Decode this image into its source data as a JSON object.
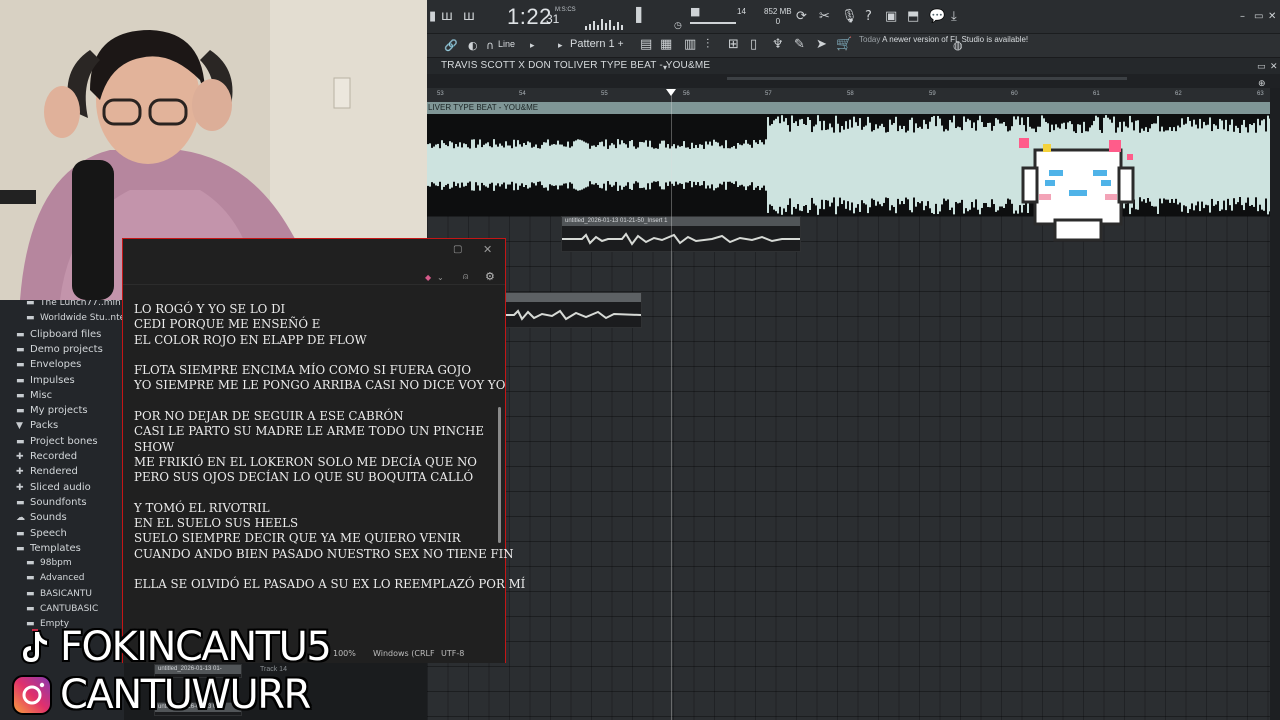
{
  "fl_studio": {
    "time_main": "1:22",
    "time_small": "31",
    "time_unit": "M:S:CS",
    "cpu": "14",
    "memory": "852 MB",
    "memory_sub": "0",
    "snap_mode": "Line",
    "pattern": "Pattern 1",
    "update_notice_prefix": "Today",
    "update_notice": "A newer version of FL Studio is available!",
    "playlist_title": "TRAVIS SCOTT X DON TOLIVER TYPE BEAT - YOU&ME",
    "clip_name": "LIVER TYPE BEAT - YOU&ME",
    "bar_numbers": [
      "53",
      "54",
      "55",
      "56",
      "57",
      "58",
      "59",
      "60",
      "61",
      "62",
      "63"
    ],
    "recording_clip": "untitled_2026-01-13 01-21-50_Insert 1",
    "bottom_clip": "untitled_2026-01-13 01-",
    "bottom_clip2": "untitled_2026-01-13 01-",
    "track_label": "Track 14"
  },
  "browser": {
    "items": [
      {
        "label": "The Lunch77..min Dr",
        "icon": "folder-icon",
        "sub": true
      },
      {
        "label": "Worldwide Stu..nters E",
        "icon": "folder-icon",
        "sub": true
      },
      {
        "label": "Clipboard files",
        "icon": "folder-icon",
        "sub": false
      },
      {
        "label": "Demo projects",
        "icon": "folder-icon",
        "sub": false
      },
      {
        "label": "Envelopes",
        "icon": "folder-icon",
        "sub": false
      },
      {
        "label": "Impulses",
        "icon": "folder-icon",
        "sub": false
      },
      {
        "label": "Misc",
        "icon": "folder-icon",
        "sub": false
      },
      {
        "label": "My projects",
        "icon": "folder-icon",
        "sub": false
      },
      {
        "label": "Packs",
        "icon": "packs-icon",
        "sub": false
      },
      {
        "label": "Project bones",
        "icon": "folder-icon",
        "sub": false
      },
      {
        "label": "Recorded",
        "icon": "plus-icon",
        "sub": false
      },
      {
        "label": "Rendered",
        "icon": "plus-icon",
        "sub": false
      },
      {
        "label": "Sliced audio",
        "icon": "plus-icon",
        "sub": false
      },
      {
        "label": "Soundfonts",
        "icon": "folder-icon",
        "sub": false
      },
      {
        "label": "Sounds",
        "icon": "cloud-icon",
        "sub": false
      },
      {
        "label": "Speech",
        "icon": "folder-icon",
        "sub": false
      },
      {
        "label": "Templates",
        "icon": "folder-icon",
        "sub": false
      },
      {
        "label": "98bpm",
        "icon": "folder-icon",
        "sub": true
      },
      {
        "label": "Advanced",
        "icon": "folder-icon",
        "sub": true
      },
      {
        "label": "BASICANTÚ",
        "icon": "folder-icon",
        "sub": true
      },
      {
        "label": "CANTUBASIC",
        "icon": "folder-icon",
        "sub": true
      },
      {
        "label": "Empty",
        "icon": "folder-icon",
        "sub": true
      }
    ]
  },
  "notepad": {
    "lines": [
      "LO ROGÓ Y YO SE LO DI",
      "CEDI PORQUE ME ENSEÑÓ E",
      "EL COLOR ROJO EN ELAPP DE FLOW",
      "",
      "FLOTA SIEMPRE ENCIMA MÍO COMO SI FUERA GOJO",
      "YO SIEMPRE ME LE PONGO ARRIBA CASI NO DICE VOY YO",
      "",
      "POR NO DEJAR DE SEGUIR A ESE CABRÓN",
      "CASI LE PARTO SU MADRE LE ARME TODO UN PINCHE",
      "SHOW",
      "ME FRIKIÓ EN EL LOKERON SOLO ME DECÍA QUE NO",
      "PERO SUS OJOS DECÍAN LO QUE SU BOQUITA CALLÓ",
      "",
      "Y TOMÓ EL RIVOTRIL",
      "EN EL SUELO SUS HEELS",
      "SUELO SIEMPRE DECIR QUE YA ME QUIERO VENIR",
      "CUANDO ANDO BIEN PASADO NUESTRO SEX NO TIENE FIN",
      "",
      "ELLA SE OLVIDÓ EL PASADO A SU EX LO REEMPLAZÓ POR MÍ"
    ],
    "status_zoom": "100%",
    "status_eol": "Windows (CRLF",
    "status_encoding": "UTF-8"
  },
  "overlay": {
    "tiktok": "FOKINCANTU5",
    "instagram": "CANTUWURR",
    "tiktok_icon": "tiktok-icon",
    "instagram_icon": "instagram-icon"
  },
  "colors": {
    "waveform": "#cde3df",
    "clip_header": "#7f9696",
    "notepad_border": "#c41616"
  }
}
